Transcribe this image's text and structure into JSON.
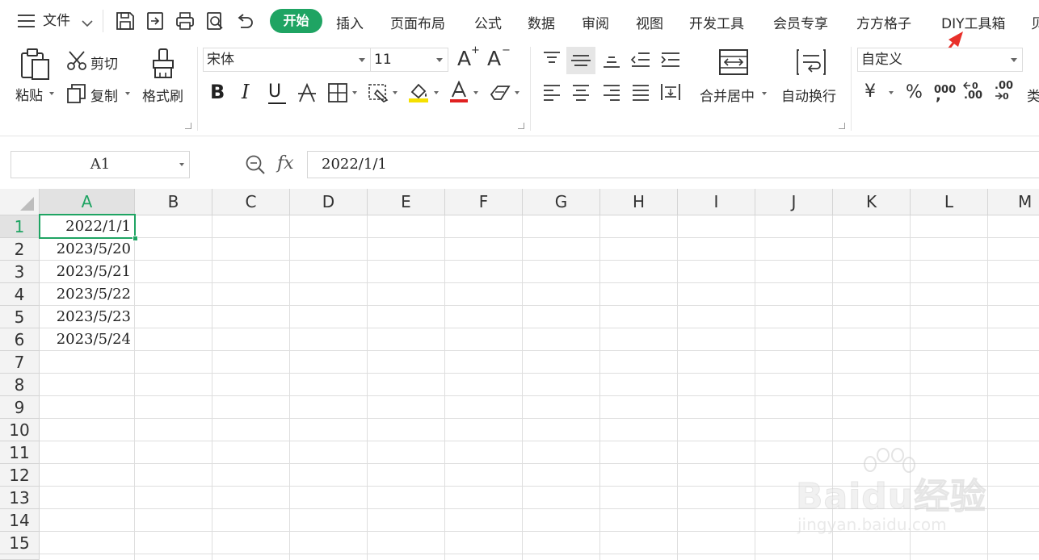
{
  "menubar": {
    "file_label": "文件",
    "tabs": [
      "开始",
      "插入",
      "页面布局",
      "公式",
      "数据",
      "审阅",
      "视图",
      "开发工具",
      "会员专享",
      "方方格子",
      "DIY工具箱",
      "贝"
    ]
  },
  "ribbon": {
    "paste_label": "粘贴",
    "cut_label": "剪切",
    "copy_label": "复制",
    "format_painter_label": "格式刷",
    "font_name": "宋体",
    "font_size": "11",
    "bold_label": "B",
    "italic_label": "I",
    "underline_label": "U",
    "font_grow_label": "A",
    "font_shrink_label": "A",
    "merge_center_label": "合并居中",
    "wrap_text_label": "自动换行",
    "number_format": "自定义",
    "currency_label": "¥",
    "percent_label": "%",
    "thousands_label": "000",
    "dec_increase_label": ".00",
    "dec_decrease_label": ".00",
    "type_label": "类"
  },
  "formula_bar": {
    "name_box": "A1",
    "fx_label": "fx",
    "formula": "2022/1/1"
  },
  "sheet": {
    "columns": [
      "A",
      "B",
      "C",
      "D",
      "E",
      "F",
      "G",
      "H",
      "I",
      "J",
      "K",
      "L",
      "M"
    ],
    "rows": [
      "1",
      "2",
      "3",
      "4",
      "5",
      "6",
      "7",
      "8",
      "9",
      "10",
      "11",
      "12",
      "13",
      "14",
      "15"
    ],
    "a_values": [
      "2022/1/1",
      "2023/5/20",
      "2023/5/21",
      "2023/5/22",
      "2023/5/23",
      "2023/5/24"
    ]
  },
  "watermark": {
    "brand": "Baidu经验",
    "url": "jingyan.baidu.com"
  },
  "colors": {
    "accent": "#1fa463",
    "annotation_arrow": "#e8302a",
    "font_color_underline": "#e02020",
    "fill_color_underline": "#f5e000"
  }
}
